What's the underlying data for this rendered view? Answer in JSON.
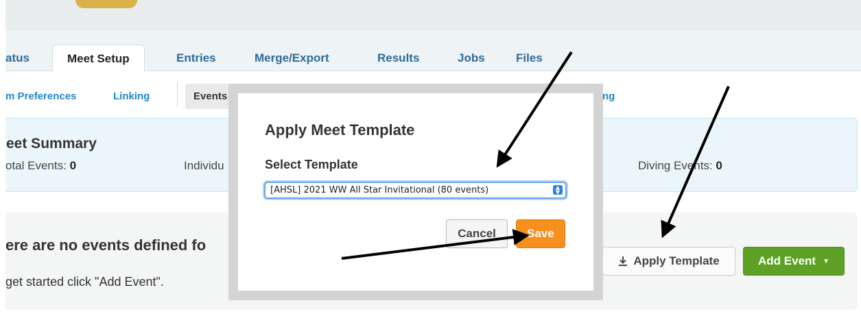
{
  "tabs": [
    {
      "label": "atus"
    },
    {
      "label": "Meet Setup",
      "active": true
    },
    {
      "label": "Entries"
    },
    {
      "label": "Merge/Export"
    },
    {
      "label": "Results"
    },
    {
      "label": "Jobs"
    },
    {
      "label": "Files"
    }
  ],
  "subnav": {
    "items": [
      "m Preferences",
      "Linking",
      "Events",
      "ng"
    ]
  },
  "summary": {
    "title": "eet Summary",
    "total_label": "otal Events: ",
    "total_value": "0",
    "individual_label": "Individu",
    "diving_label": "Diving Events: ",
    "diving_value": "0"
  },
  "empty": {
    "title": "ere are no events defined fo",
    "text": "get started click \"Add Event\"."
  },
  "buttons": {
    "apply_template": "Apply Template",
    "add_event": "Add Event"
  },
  "modal": {
    "title": "Apply Meet Template",
    "select_label": "Select Template",
    "selected_option": "[AHSL] 2021 WW All Star Invitational (80 events)",
    "cancel": "Cancel",
    "save": "Save"
  },
  "icons": {
    "apply_template": "download-icon",
    "add_event": "caret-down-icon",
    "select": "select-updown-icon"
  },
  "colors": {
    "tab_link": "#2f6b98",
    "subnav_link": "#1e88c8",
    "summary_bg": "#ebf6fb",
    "save_button": "#f7901e",
    "add_event_button": "#5ea126",
    "select_focus": "#6aa5e8"
  }
}
